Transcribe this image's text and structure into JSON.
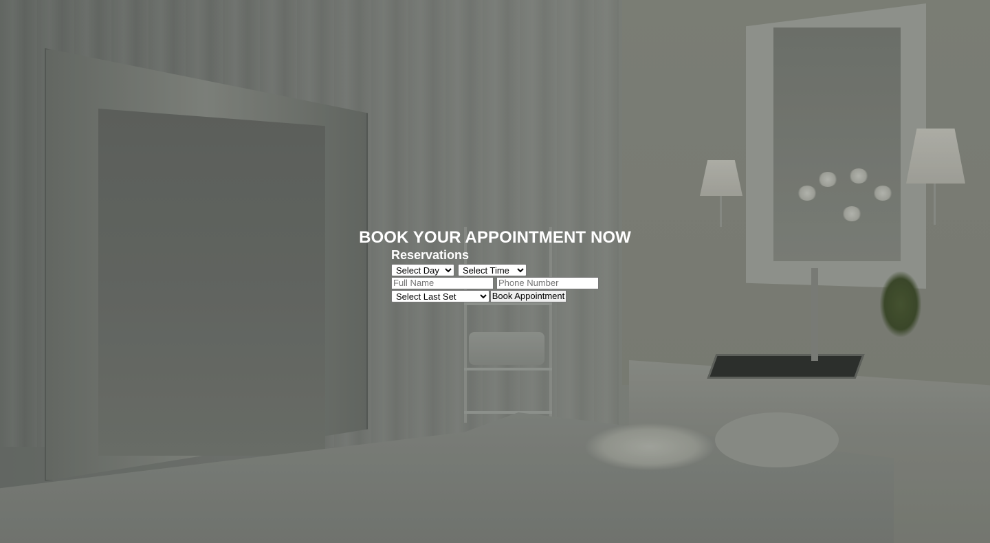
{
  "hero": {
    "heading": "BOOK YOUR APPOINTMENT NOW",
    "background_description": "spa-treatment-room-photo"
  },
  "form": {
    "title": "Reservations",
    "day_select": {
      "selected": "Select Day",
      "options": [
        "Select Day"
      ]
    },
    "time_select": {
      "selected": "Select Time",
      "options": [
        "Select Time"
      ]
    },
    "full_name": {
      "value": "",
      "placeholder": "Full Name"
    },
    "phone_number": {
      "value": "",
      "placeholder": "Phone Number"
    },
    "last_set_select": {
      "selected": "Select Last Set",
      "options": [
        "Select Last Set"
      ]
    },
    "submit_label": "Book Appointment"
  },
  "colors": {
    "heading_text": "#ffffff",
    "overlay": "#5d605c"
  }
}
